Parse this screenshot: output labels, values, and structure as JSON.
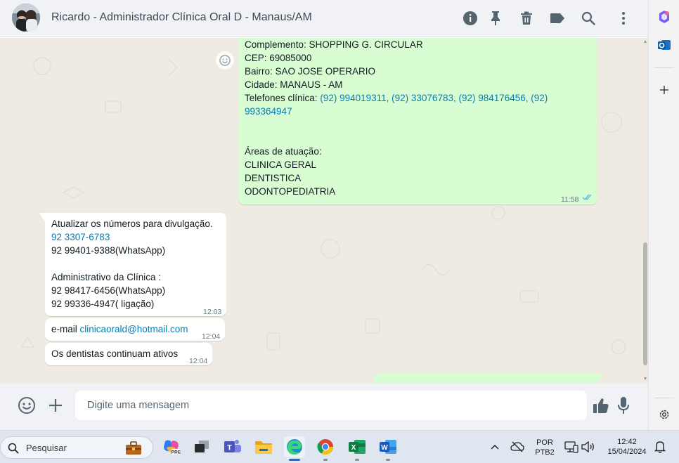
{
  "header": {
    "title": "Ricardo - Administrador Clínica Oral D - Manaus/AM",
    "icons": [
      "info-icon",
      "pin-icon",
      "delete-icon",
      "label-icon",
      "search-icon",
      "menu-icon"
    ]
  },
  "messages": {
    "outgoing_1": {
      "lines": [
        "Complemento: SHOPPING G. CIRCULAR",
        "CEP: 69085000",
        "Bairro: SAO JOSE OPERARIO",
        "Cidade: MANAUS - AM"
      ],
      "phones_label": "Telefones clínica: ",
      "phones_line1": "(92) 994019311, (92) 33076783, (92) 984176456, (92)",
      "phones_line2": "993364947",
      "areas": [
        "Áreas de atuação:",
        "CLINICA GERAL",
        "DENTISTICA",
        "ODONTOPEDIATRIA"
      ],
      "time": "11:58",
      "status": "read"
    },
    "incoming_1": {
      "line1": "Atualizar os números para divulgação.",
      "link": "92 3307-6783",
      "line3": "92 99401-9388(WhatsApp)",
      "line4": "Administrativo da Clínica :",
      "line5": "92 98417-6456(WhatsApp)",
      "line6": "92 99336-4947( ligação)",
      "time": "12:03"
    },
    "incoming_2": {
      "prefix": "e-mail ",
      "link": "clinicaorald@hotmail.com",
      "time": "12:04"
    },
    "incoming_3": {
      "text": "Os dentistas continuam ativos",
      "time": "12:04"
    }
  },
  "composer": {
    "placeholder": "Digite uma mensagem"
  },
  "taskbar": {
    "search_label": "Pesquisar",
    "apps": [
      "widgets-icon",
      "copilot-icon",
      "task-view-icon",
      "teams-icon",
      "file-explorer-icon",
      "edge-icon",
      "chrome-icon",
      "excel-icon",
      "word-icon"
    ],
    "language_1": "POR",
    "language_2": "PTB2",
    "clock_time": "12:42",
    "clock_date": "15/04/2024"
  },
  "colors": {
    "outgoing_bubble": "#d9fdd3",
    "incoming_bubble": "#ffffff",
    "chat_background": "#efeae2",
    "link": "#027eb5",
    "read_ticks": "#53bdeb"
  }
}
